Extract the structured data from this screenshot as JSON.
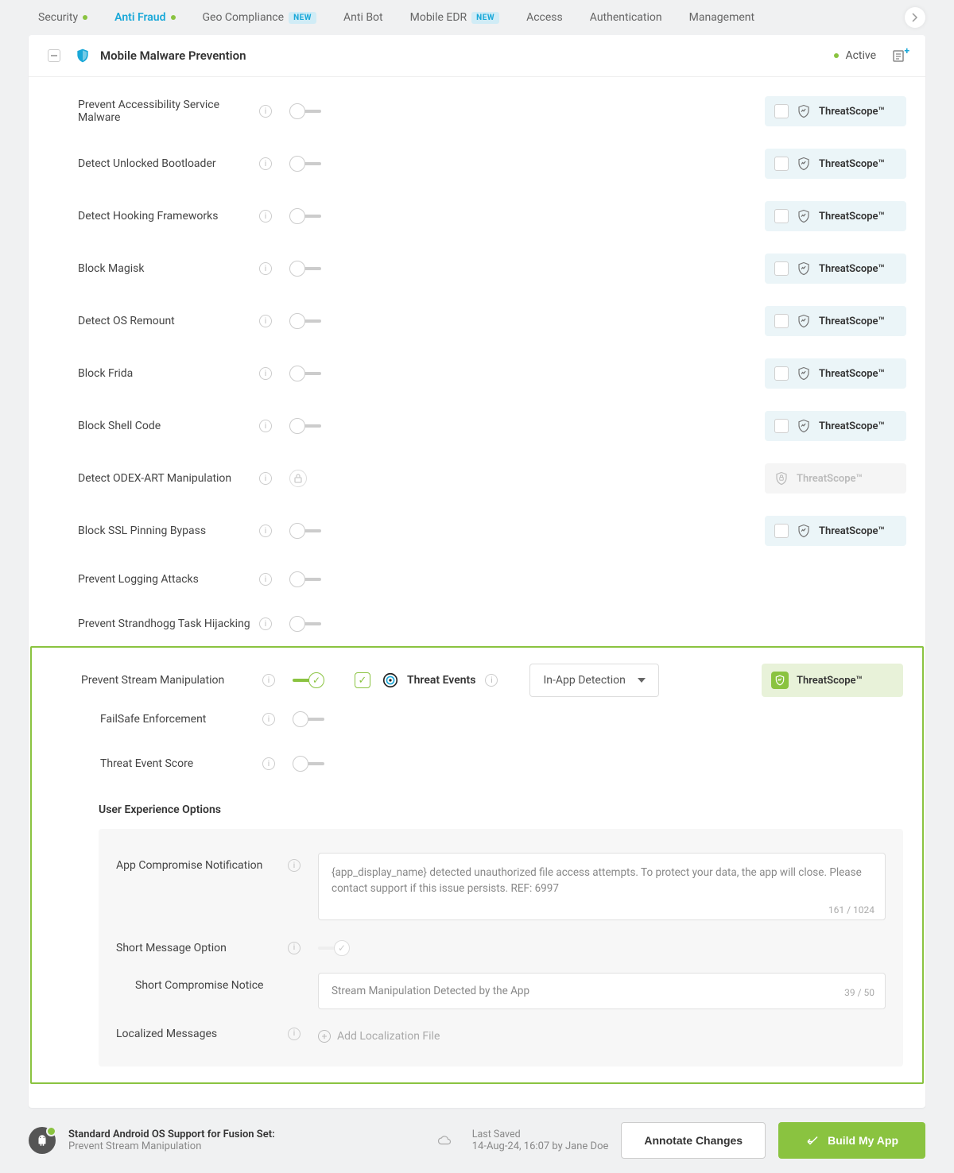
{
  "tabs": [
    {
      "label": "Security",
      "active": false,
      "dot": true
    },
    {
      "label": "Anti Fraud",
      "active": true,
      "dot": true
    },
    {
      "label": "Geo Compliance",
      "badge": "NEW"
    },
    {
      "label": "Anti Bot"
    },
    {
      "label": "Mobile EDR",
      "badge": "NEW"
    },
    {
      "label": "Access"
    },
    {
      "label": "Authentication"
    },
    {
      "label": "Management"
    }
  ],
  "panel": {
    "title": "Mobile Malware Prevention",
    "status": "Active"
  },
  "threatscope_label": "ThreatScope™",
  "rows": [
    {
      "label": "Prevent Accessibility Service Malware",
      "ts": "chip"
    },
    {
      "label": "Detect Unlocked Bootloader",
      "ts": "chip"
    },
    {
      "label": "Detect Hooking Frameworks",
      "ts": "chip"
    },
    {
      "label": "Block Magisk",
      "ts": "chip"
    },
    {
      "label": "Detect OS Remount",
      "ts": "chip"
    },
    {
      "label": "Block Frida",
      "ts": "chip"
    },
    {
      "label": "Block Shell Code",
      "ts": "chip"
    },
    {
      "label": "Detect ODEX-ART Manipulation",
      "ts": "disabled",
      "locked": true
    },
    {
      "label": "Block SSL Pinning Bypass",
      "ts": "chip"
    },
    {
      "label": "Prevent Logging Attacks",
      "ts": "none"
    },
    {
      "label": "Prevent Strandhogg Task Hijacking",
      "ts": "none"
    }
  ],
  "expanded": {
    "title": "Prevent Stream Manipulation",
    "threat_events_label": "Threat Events",
    "select_value": "In-App Detection",
    "sub_rows": [
      {
        "label": "FailSafe Enforcement"
      },
      {
        "label": "Threat Event Score"
      }
    ],
    "uxo_title": "User Experience Options",
    "notification": {
      "label": "App Compromise Notification",
      "value": "{app_display_name} detected unauthorized file access attempts. To protect your data, the app will close. Please contact support if this issue persists. REF: 6997",
      "counter": "161 / 1024"
    },
    "short_msg_label": "Short Message Option",
    "short_notice": {
      "label": "Short Compromise Notice",
      "value": "Stream Manipulation Detected by the App",
      "counter": "39 / 50"
    },
    "localized_label": "Localized Messages",
    "add_localization": "Add Localization File"
  },
  "footer": {
    "title": "Standard Android OS Support for Fusion Set:",
    "subtitle": "Prevent Stream Manipulation",
    "last_saved_label": "Last Saved",
    "last_saved_value": "14-Aug-24, 16:07 by Jane Doe",
    "annotate_btn": "Annotate Changes",
    "build_btn": "Build My App"
  }
}
